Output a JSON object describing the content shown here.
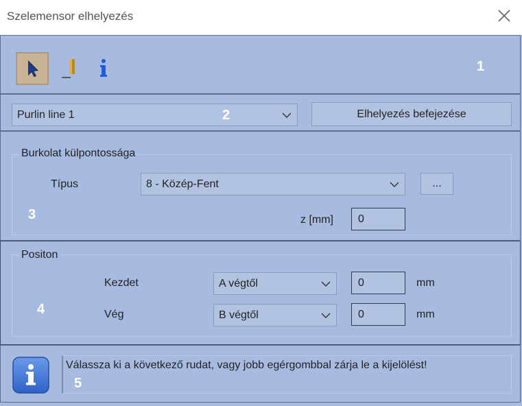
{
  "window": {
    "title": "Szelemensor elhelyezés"
  },
  "toolbar": {
    "marker": "1"
  },
  "row2": {
    "marker": "2",
    "line_select": "Purlin line 1",
    "finish_button": "Elhelyezés befejezése"
  },
  "cladding": {
    "marker": "3",
    "legend": "Burkolat külpontossága",
    "type_label": "Típus",
    "type_value": "8 - Közép-Fent",
    "more_button": "...",
    "z_label": "z [mm]",
    "z_value": "0"
  },
  "position": {
    "marker": "4",
    "legend": "Positon",
    "start_label": "Kezdet",
    "start_ref": "A végtől",
    "start_value": "0",
    "start_unit": "mm",
    "end_label": "Vég",
    "end_ref": "B végtől",
    "end_value": "0",
    "end_unit": "mm"
  },
  "status": {
    "marker": "5",
    "message": "Válassza ki a következő rudat, vagy jobb egérgombbal zárja le a kijelölést!"
  },
  "colors": {
    "panel": "#a6bbdf",
    "field": "#b2c3e2",
    "accent_info": "#3a74d6",
    "marker_text": "#ffffff"
  }
}
